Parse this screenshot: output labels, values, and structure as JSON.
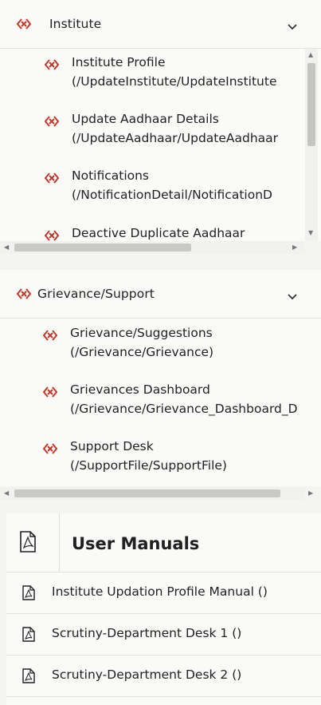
{
  "institute": {
    "title": "Institute",
    "items": [
      {
        "name": "Institute Profile",
        "path": "(/UpdateInstitute/UpdateInstitute"
      },
      {
        "name": "Update Aadhaar Details",
        "path": "(/UpdateAadhaar/UpdateAadhaar"
      },
      {
        "name": "Notifications",
        "path": "(/NotificationDetail/NotificationD"
      },
      {
        "name": "Deactive Duplicate Aadhaar",
        "path": ""
      }
    ]
  },
  "grievance": {
    "title": "Grievance/Support",
    "items": [
      {
        "name": "Grievance/Suggestions",
        "path": "(/Grievance/Grievance)"
      },
      {
        "name": "Grievances Dashboard",
        "path": "(/Grievance/Grievance_Dashboard_D"
      },
      {
        "name": "Support Desk",
        "path": "(/SupportFile/SupportFile)"
      }
    ]
  },
  "manuals": {
    "title": "User Manuals",
    "items": [
      {
        "label": "Institute Updation Profile Manual ()"
      },
      {
        "label": "Scrutiny-Department Desk 1 ()"
      },
      {
        "label": "Scrutiny-Department Desk 2 ()"
      }
    ]
  },
  "colors": {
    "accent": "#c0392b"
  },
  "icons": {
    "menu": "diamond-link-icon",
    "chevron": "chevron-down-icon",
    "pdf": "pdf-file-icon"
  }
}
